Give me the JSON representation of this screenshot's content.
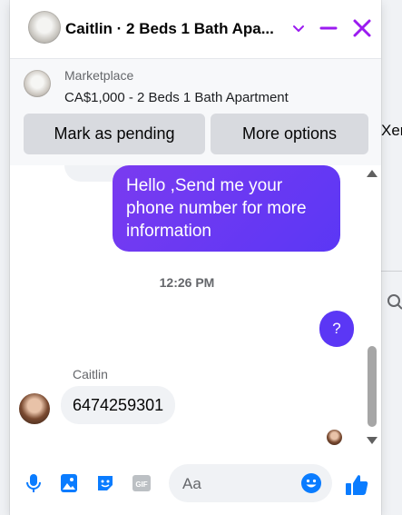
{
  "colors": {
    "accent": "#5b37f5",
    "header_icons": "#9b1bf0",
    "composer_icons": "#0a7cff",
    "outgoing_bubble": "#6a39f3"
  },
  "background": {
    "partial_text": "Xen"
  },
  "header": {
    "title": "Caitlin · 2 Beds 1 Bath Apa...",
    "icons": [
      "chevron-down-icon",
      "minimize-icon",
      "close-icon"
    ]
  },
  "marketplace": {
    "label": "Marketplace",
    "listing": "CA$1,000 - 2 Beds 1 Bath Apartment",
    "buttons": {
      "mark_pending": "Mark as pending",
      "more_options": "More options"
    }
  },
  "messages": {
    "outgoing_text": "Hello ,Send me your phone number for more information",
    "timestamp": "12:26 PM",
    "outgoing_short": "?",
    "sender_name": "Caitlin",
    "incoming_text": "6474259301"
  },
  "composer": {
    "placeholder": "Aa",
    "icons": [
      "microphone-icon",
      "photo-icon",
      "sticker-icon",
      "gif-icon",
      "emoji-icon",
      "thumbs-up-icon"
    ],
    "gif_label": "GIF"
  }
}
